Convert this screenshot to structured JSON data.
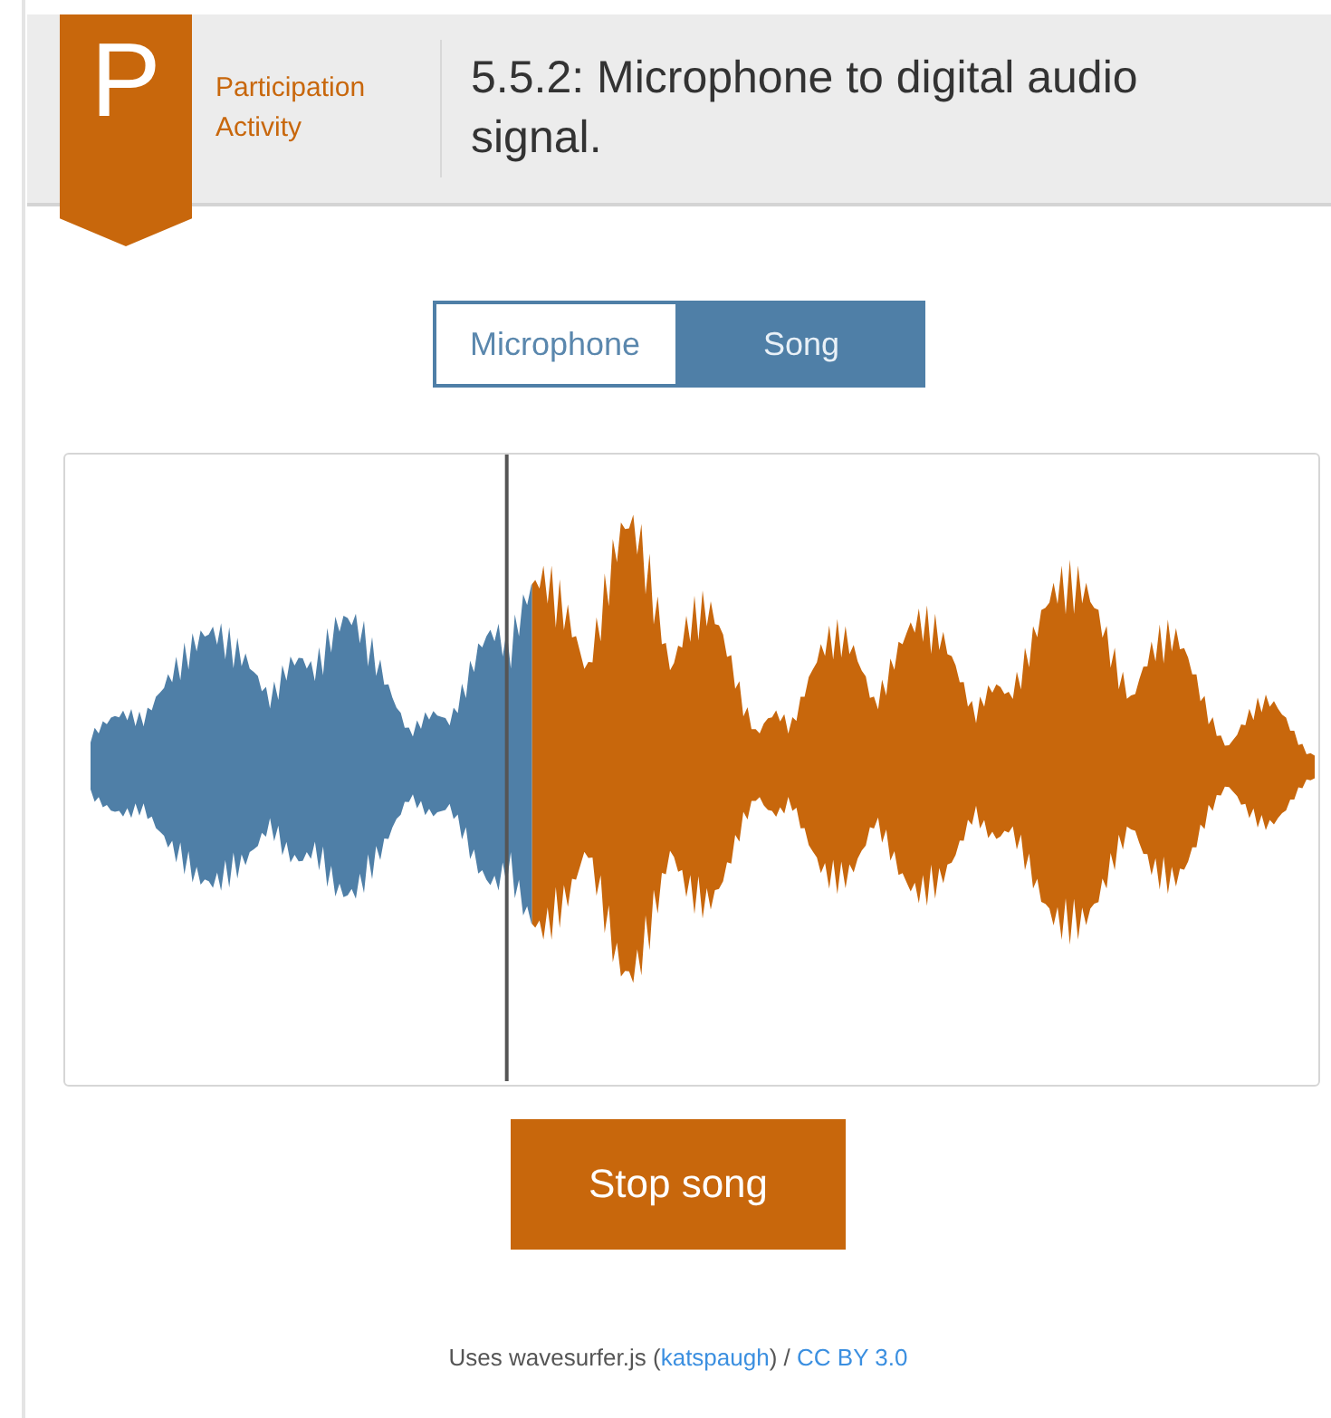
{
  "header": {
    "badge": "P",
    "activity_type": "Participation Activity",
    "title": "5.5.2: Microphone to digital audio signal."
  },
  "source_toggle": [
    {
      "label": "Microphone",
      "selected": false
    },
    {
      "label": "Song",
      "selected": true
    }
  ],
  "waveform": {
    "level": 0.34
  },
  "action_button": "Stop song",
  "footer": [
    {
      "kind": "text",
      "text": "Uses wavesurfer.js ("
    },
    {
      "kind": "link",
      "text": "katspaugh"
    },
    {
      "kind": "text",
      "text": ") / "
    },
    {
      "kind": "link",
      "text": "CC BY 3.0"
    }
  ]
}
